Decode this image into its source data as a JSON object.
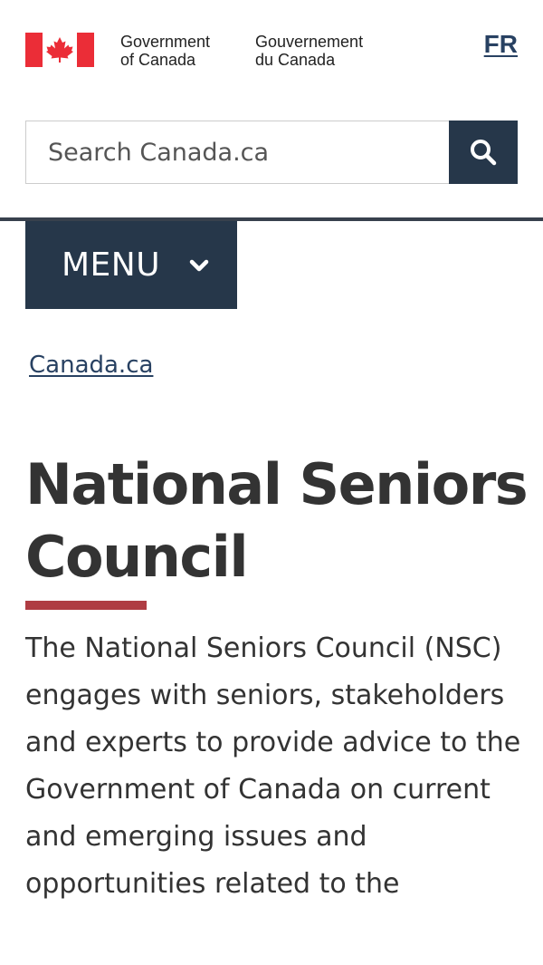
{
  "header": {
    "signature": {
      "en_line1": "Government",
      "en_line2": "of Canada",
      "fr_line1": "Gouvernement",
      "fr_line2": "du Canada",
      "flag_colors": {
        "red": "#eb2d37",
        "white": "#ffffff"
      }
    },
    "language_toggle": "FR"
  },
  "search": {
    "placeholder": "Search Canada.ca",
    "button_icon": "search-icon"
  },
  "menu": {
    "label": "MENU",
    "icon": "chevron-down-icon"
  },
  "breadcrumb": {
    "items": [
      "Canada.ca"
    ]
  },
  "main": {
    "title": "National Seniors Council",
    "intro": "The National Seniors Council (NSC) engages with seniors, stakeholders and experts to provide advice to the Government of Canada on current and emerging issues and opportunities related to the"
  },
  "colors": {
    "primary_dark": "#26374a",
    "link": "#284162",
    "accent_red": "#af3c43",
    "text": "#333333"
  }
}
